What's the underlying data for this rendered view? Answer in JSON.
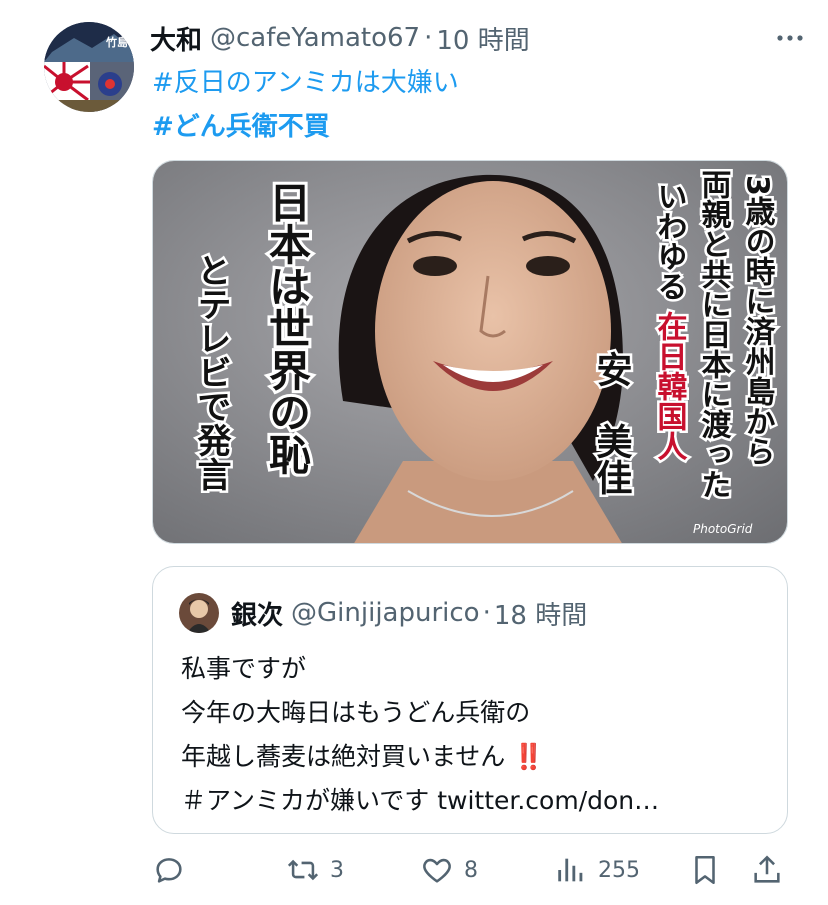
{
  "tweet": {
    "display_name": "大和",
    "handle": "@cafeYamato67",
    "separator": "·",
    "time": "10 時間",
    "hashtags": [
      "#反日のアンミカは大嫌い",
      "#どん兵衛不買"
    ],
    "media": {
      "vertical_text_left_1": "日本は世界の恥",
      "vertical_text_left_2": "とテレビで発言",
      "vertical_text_right_1": "3歳の時に済州島から",
      "vertical_text_right_2": "両親と共に日本に渡った",
      "vertical_text_right_3a": "いわゆる",
      "vertical_text_right_3b": "在日韓国人",
      "vertical_name": "安　美佳",
      "watermark": "PhotoGrid"
    },
    "avatar_text": "竹島"
  },
  "quote": {
    "display_name": "銀次",
    "handle": "@Ginjijapurico",
    "separator": "·",
    "time": "18 時間",
    "lines": [
      "私事ですが",
      "今年の大晦日はもうどん兵衛の",
      "年越し蕎麦は絶対買いません",
      "＃アンミカが嫌いです twitter.com/don…"
    ],
    "emoji": "‼️"
  },
  "actions": {
    "reply": {
      "icon": "reply-icon",
      "count": ""
    },
    "retweet": {
      "icon": "retweet-icon",
      "count": "3"
    },
    "like": {
      "icon": "heart-icon",
      "count": "8"
    },
    "views": {
      "icon": "views-icon",
      "count": "255"
    },
    "bookmark": {
      "icon": "bookmark-icon"
    },
    "share": {
      "icon": "share-icon"
    }
  },
  "colors": {
    "link": "#1d9bf0",
    "secondary": "#536471",
    "border": "#cfd9de",
    "accent_red": "#d9241c"
  }
}
